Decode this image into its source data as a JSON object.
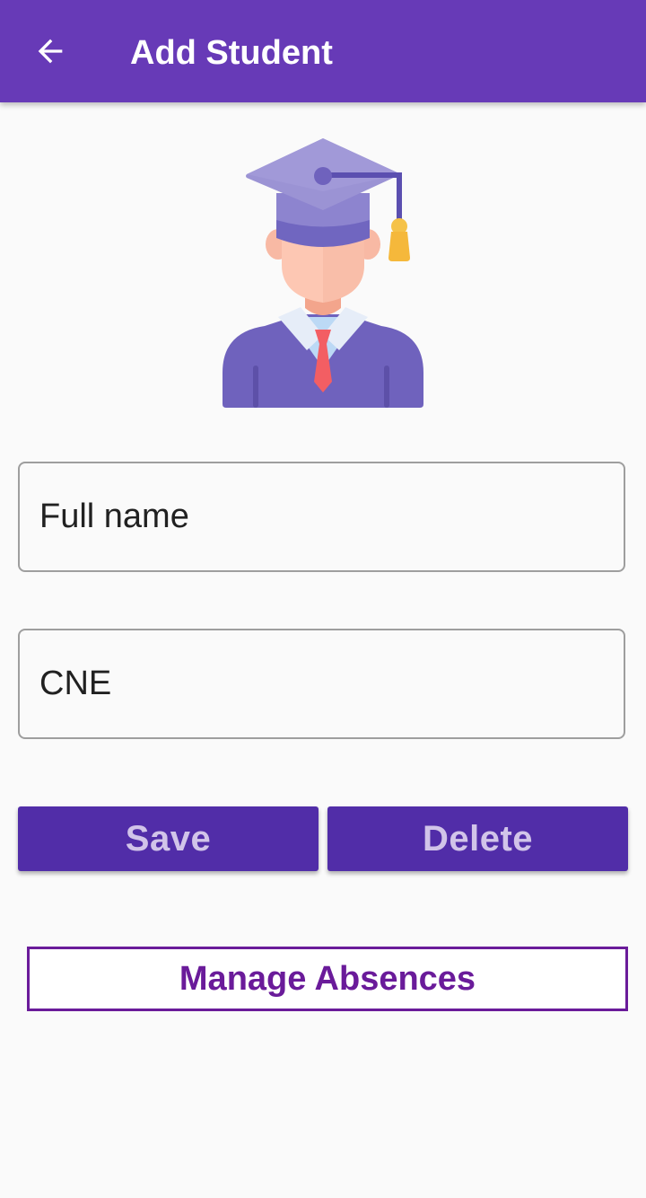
{
  "app_bar": {
    "title": "Add Student",
    "back_icon": "arrow-left-icon",
    "background": "#673ab7"
  },
  "avatar": {
    "icon": "graduate-student-icon"
  },
  "form": {
    "full_name": {
      "placeholder": "Full name",
      "value": ""
    },
    "cne": {
      "placeholder": "CNE",
      "value": ""
    }
  },
  "actions": {
    "save_label": "Save",
    "delete_label": "Delete",
    "button_color": "#512da8",
    "button_text_color": "#d1c4e9"
  },
  "manage_absences": {
    "label": "Manage Absences",
    "color": "#6a1b9a"
  }
}
